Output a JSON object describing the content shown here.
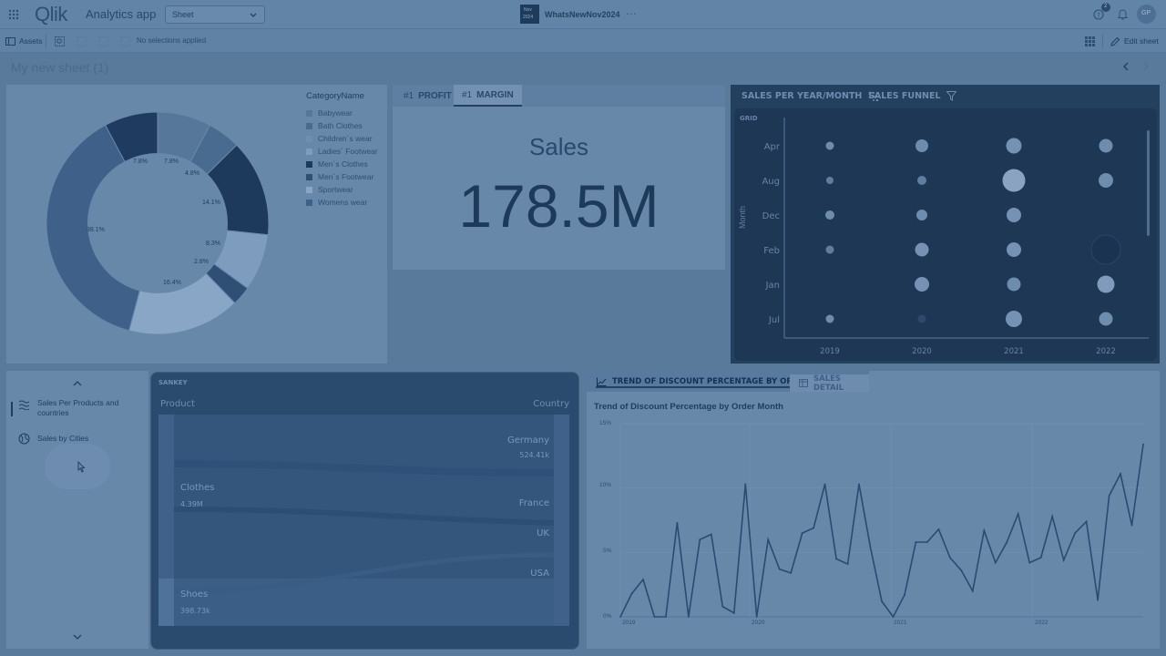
{
  "header": {
    "app_title": "Analytics app",
    "view_select": "Sheet",
    "date_badge_line1": "Nov",
    "date_badge_line2": "2024",
    "app_name": "WhatsNewNov2024",
    "more": "⋯",
    "notification_count": "2",
    "avatar_initials": "GP",
    "logo_text": "Qlik"
  },
  "toolbar": {
    "assets_label": "Assets",
    "selections_text": "No selections applied",
    "edit_sheet_label": "Edit sheet"
  },
  "sheet": {
    "title": "My new sheet (1)"
  },
  "donut": {
    "legend_title": "CategoryName",
    "legend": [
      {
        "label": "Babywear",
        "color": "#56769a"
      },
      {
        "label": "Bath Clothes",
        "color": "#4a6b90"
      },
      {
        "label": "Children´s wear",
        "color": "#6f8fb2"
      },
      {
        "label": "Ladies´ Footwear",
        "color": "#7d9cbe"
      },
      {
        "label": "Men´s Clothes",
        "color": "#1d3a5c"
      },
      {
        "label": "Men´s Footwear",
        "color": "#2f4f74"
      },
      {
        "label": "Sportwear",
        "color": "#8aa6c6"
      },
      {
        "label": "Womens wear",
        "color": "#3f6089"
      }
    ],
    "slice_labels": [
      "7.8%",
      "7.8%",
      "4.8%",
      "14.1%",
      "8.3%",
      "2.8%",
      "16.4%",
      "38.1%"
    ]
  },
  "kpi": {
    "tabs": [
      {
        "prefix": "#1",
        "label": "PROFIT"
      },
      {
        "prefix": "#1",
        "label": "MARGIN"
      }
    ],
    "title": "Sales",
    "value": "178.5M"
  },
  "grid_chart": {
    "tabs": [
      "SALES PER YEAR/MONTH",
      "SALES FUNNEL"
    ],
    "badge": "GRID",
    "y_axis_label": "Month",
    "months": [
      "Apr",
      "Aug",
      "Dec",
      "Feb",
      "Jan",
      "Jul"
    ],
    "years": [
      "2019",
      "2020",
      "2021",
      "2022"
    ]
  },
  "sheet_list": {
    "items": [
      {
        "label": "Sales Per Products and countries"
      },
      {
        "label": "Sales by Cities"
      }
    ]
  },
  "sankey": {
    "badge": "SANKEY",
    "left_header": "Product",
    "right_header": "Country",
    "left_nodes": [
      {
        "label": "Clothes",
        "value": "4.39M"
      },
      {
        "label": "Shoes",
        "value": "398.73k"
      }
    ],
    "right_nodes": [
      {
        "label": "Germany",
        "value": "524.41k"
      },
      {
        "label": "France",
        "value": ""
      },
      {
        "label": "UK",
        "value": ""
      },
      {
        "label": "USA",
        "value": ""
      }
    ]
  },
  "trend": {
    "tabs": [
      "TREND OF DISCOUNT PERCENTAGE BY ORDER MONTH",
      "SALES DETAIL"
    ],
    "title": "Trend of Discount Percentage by Order Month",
    "y_ticks": [
      "15%",
      "10%",
      "5%",
      "0%"
    ],
    "x_ticks": [
      "2019",
      "2020",
      "2021",
      "2022"
    ]
  },
  "chart_data": {
    "type": "line",
    "title": "Trend of Discount Percentage by Order Month",
    "xlabel": "",
    "ylabel": "",
    "ylim": [
      0,
      15
    ],
    "x": [
      "2019-01",
      "2019-02",
      "2019-03",
      "2019-04",
      "2019-05",
      "2019-06",
      "2019-07",
      "2019-08",
      "2019-09",
      "2019-10",
      "2019-11",
      "2019-12",
      "2020-01",
      "2020-02",
      "2020-03",
      "2020-04",
      "2020-05",
      "2020-06",
      "2020-07",
      "2020-08",
      "2020-09",
      "2020-10",
      "2020-11",
      "2020-12",
      "2021-01",
      "2021-02",
      "2021-03",
      "2021-04",
      "2021-05",
      "2021-06",
      "2021-07",
      "2021-08",
      "2021-09",
      "2021-10",
      "2021-11",
      "2021-12",
      "2022-01",
      "2022-02",
      "2022-03",
      "2022-04",
      "2022-05",
      "2022-06",
      "2022-07",
      "2022-08",
      "2022-09",
      "2022-10"
    ],
    "values": [
      0,
      1.8,
      2.9,
      0,
      0,
      7.3,
      0,
      6,
      6.4,
      0.8,
      0.3,
      10.3,
      0,
      6,
      3.7,
      3.4,
      6.5,
      6.9,
      10.3,
      4.5,
      4.1,
      10.3,
      5.4,
      1.2,
      0,
      1.7,
      5.8,
      5.8,
      6.8,
      4.6,
      3.6,
      2,
      6.7,
      4.2,
      5.8,
      8,
      4.2,
      4.6,
      7.8,
      4.4,
      6.5,
      7.4,
      1.3,
      9.4,
      11.1,
      7.1,
      13.4
    ]
  }
}
